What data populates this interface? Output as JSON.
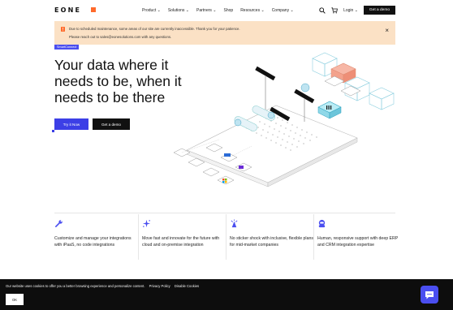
{
  "brand": {
    "logo_text": "EONE",
    "accent": "#ff6a2b"
  },
  "nav": {
    "links": [
      "Product",
      "Solutions",
      "Partners",
      "Shop",
      "Resources",
      "Company"
    ],
    "login_label": "Login",
    "demo_label": "Get a demo"
  },
  "banner": {
    "line1": "Due to scheduled maintenance, some areas of our site are currently inaccessible. Thank you for your patience.",
    "line2": "Please reach out to sales@eonesolutions.com with any questions.",
    "bg": "#fbe1c5"
  },
  "hero": {
    "tag": "SmartConnect",
    "headline_lines": [
      "Your data where it",
      "needs to be, when it",
      "needs to be there"
    ],
    "try_label": "Try it Now",
    "demo_label": "Get a demo",
    "primary_color": "#3c3fe6"
  },
  "features": [
    {
      "icon": "wrench-icon",
      "text": "Customize and manage your integrations with iPaaS, no code integrations"
    },
    {
      "icon": "sparkle-icon",
      "text": "Move fast and innovate for the future with cloud and on-premise integration"
    },
    {
      "icon": "sticker-icon",
      "text": "No sticker shock with inclusive, flexible plans for mid-market companies"
    },
    {
      "icon": "support-icon",
      "text": "Human, responsive support with deep ERP and CRM integration expertise"
    }
  ],
  "cookie": {
    "message": "Our website uses cookies to offer you a better browsing experience and personalize content.",
    "privacy_label": "Privacy Policy",
    "disable_label": "Disable Cookies",
    "ok_label": "OK"
  }
}
